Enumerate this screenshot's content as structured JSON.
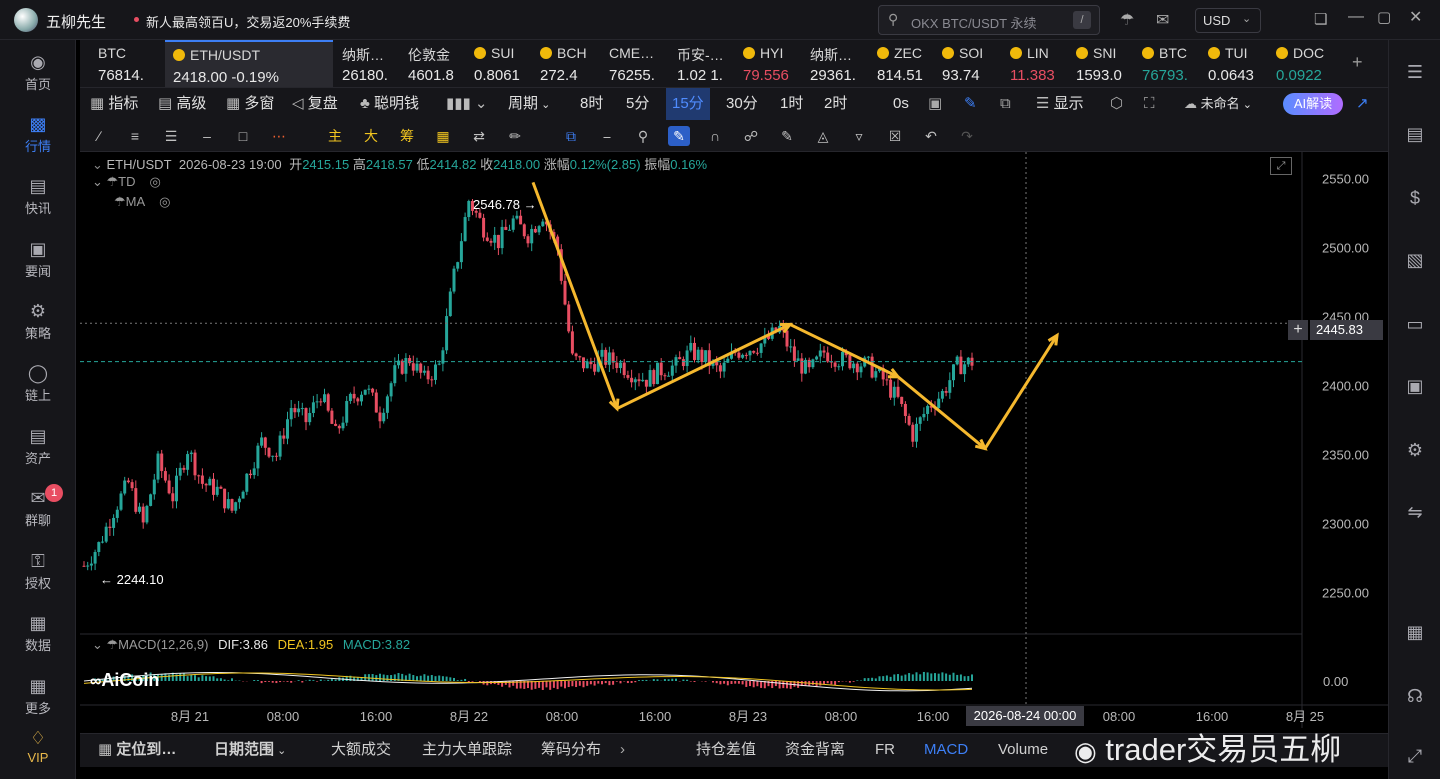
{
  "app": {
    "name": "五柳先生",
    "promo": "新人最高领百U，交易返20%手续费",
    "search_placeholder": "OKX BTC/USDT 永续",
    "search_key": "/",
    "currency": "USD"
  },
  "sidebar": {
    "items": [
      {
        "label": "首页",
        "icon": "home-icon"
      },
      {
        "label": "行情",
        "icon": "chart-icon"
      },
      {
        "label": "快讯",
        "icon": "news-icon"
      },
      {
        "label": "要闻",
        "icon": "headlines-icon"
      },
      {
        "label": "策略",
        "icon": "robot-icon"
      },
      {
        "label": "链上",
        "icon": "chain-icon"
      },
      {
        "label": "资产",
        "icon": "wallet-icon"
      },
      {
        "label": "群聊",
        "icon": "chat-icon",
        "badge": "1"
      },
      {
        "label": "授权",
        "icon": "key-icon"
      },
      {
        "label": "数据",
        "icon": "data-icon"
      },
      {
        "label": "更多",
        "icon": "more-icon"
      },
      {
        "label": "VIP",
        "icon": "vip-icon"
      }
    ]
  },
  "tickers": [
    {
      "name": "BTC",
      "price": "76814.",
      "color": "#e8e8e8"
    },
    {
      "name": "ETH/USDT",
      "price": "2418.00",
      "change": "-0.19%",
      "color": "#e8e8e8"
    },
    {
      "name": "纳斯…",
      "price": "26180.",
      "color": "#e8e8e8"
    },
    {
      "name": "伦敦金",
      "price": "4601.8",
      "color": "#e8e8e8"
    },
    {
      "name": "SUI",
      "price": "0.8061",
      "color": "#e8e8e8"
    },
    {
      "name": "BCH",
      "price": "272.4",
      "color": "#e8e8e8"
    },
    {
      "name": "CME…",
      "price": "76255.",
      "color": "#e8e8e8"
    },
    {
      "name": "币安-…",
      "price": "1.02 1.",
      "color": "#e8e8e8"
    },
    {
      "name": "HYI",
      "price": "79.556",
      "color": "#e84e62"
    },
    {
      "name": "纳斯…",
      "price": "29361.",
      "color": "#e8e8e8"
    },
    {
      "name": "ZEC",
      "price": "814.51",
      "color": "#e8e8e8"
    },
    {
      "name": "SOI",
      "price": "93.74",
      "color": "#e8e8e8"
    },
    {
      "name": "LIN",
      "price": "11.383",
      "color": "#e84e62"
    },
    {
      "name": "SNI",
      "price": "1593.0",
      "color": "#e8e8e8"
    },
    {
      "name": "BTC",
      "price": "76793.",
      "color": "#26a69a"
    },
    {
      "name": "TUI",
      "price": "0.0643",
      "color": "#e8e8e8"
    },
    {
      "name": "DOC",
      "price": "0.0922",
      "color": "#26a69a"
    }
  ],
  "toolbar": {
    "indicators": "指标",
    "advanced": "高级",
    "multi": "多窗",
    "replay": "复盘",
    "smart": "聪明钱",
    "period": "周期",
    "intervals": [
      "8时",
      "5分",
      "15分",
      "30分",
      "1时",
      "2时"
    ],
    "active_interval": "15分",
    "countdown": "0s",
    "display": "显示",
    "unnamed": "未命名",
    "ai": "AI解读"
  },
  "drawbar": {
    "labels": [
      "主",
      "大",
      "筹"
    ]
  },
  "chart_info": {
    "symbol": "ETH/USDT",
    "datetime": "2026-08-23 19:00",
    "open_l": "开",
    "open": "2415.15",
    "high_l": "高",
    "high": "2418.57",
    "low_l": "低",
    "low": "2414.82",
    "close_l": "收",
    "close": "2418.00",
    "chg_l": "涨幅",
    "chg": "0.12%(2.85)",
    "amp_l": "振幅",
    "amp": "0.16%",
    "td": "TD",
    "ma": "MA"
  },
  "chart_data": {
    "type": "candlestick",
    "symbol": "ETH/USDT",
    "interval": "15m",
    "y_ticks": [
      2550,
      2500,
      2450,
      2400,
      2350,
      2300,
      2250
    ],
    "y_tick_labels": [
      "2550.00",
      "2500.00",
      "2450.00",
      "2400.00",
      "2350.00",
      "2300.00",
      "2250.00"
    ],
    "ylim": [
      2222,
      2570
    ],
    "x_labels": [
      "8月 21",
      "08:00",
      "16:00",
      "8月 22",
      "08:00",
      "16:00",
      "8月 23",
      "08:00",
      "16:00",
      "08:00",
      "16:00",
      "8月 25"
    ],
    "crosshair_time": "2026-08-24 00:00",
    "crosshair_price": "2445.83",
    "last_price": 2418.0,
    "max_label": "2546.78",
    "min_label": "2244.10",
    "close_path": [
      2270,
      2285,
      2310,
      2330,
      2300,
      2345,
      2320,
      2355,
      2330,
      2325,
      2310,
      2335,
      2360,
      2350,
      2385,
      2375,
      2395,
      2365,
      2390,
      2400,
      2380,
      2410,
      2420,
      2405,
      2415,
      2480,
      2535,
      2515,
      2505,
      2520,
      2510,
      2525,
      2500,
      2420,
      2415,
      2420,
      2418,
      2410,
      2405,
      2412,
      2415,
      2425,
      2420,
      2410,
      2425,
      2428,
      2432,
      2442,
      2420,
      2410,
      2425,
      2420,
      2418,
      2415,
      2405,
      2390,
      2365,
      2385,
      2395,
      2415,
      2418
    ],
    "arrows": [
      [
        2548,
        2384,
        2445,
        2407,
        2355,
        2437,
        2288
      ]
    ],
    "macd": {
      "label": "MACD(12,26,9)",
      "dif": "DIF:3.86",
      "dea": "DEA:1.95",
      "macd": "MACD:3.82",
      "zero": "0.00"
    }
  },
  "bottom": {
    "locate": "定位到…",
    "date_range": "日期范围",
    "tabs": [
      "大额成交",
      "主力大单跟踪",
      "筹码分布",
      "持仓差值",
      "资金背离",
      "FR",
      "MACD",
      "Volume"
    ],
    "active_tab": "MACD",
    "watermark": "trader交易员五柳"
  },
  "logo": "AiCoin",
  "colors": {
    "up": "#26a69a",
    "down": "#e84e62",
    "accent": "#3d7ff5",
    "arrow": "#f5b82e"
  }
}
